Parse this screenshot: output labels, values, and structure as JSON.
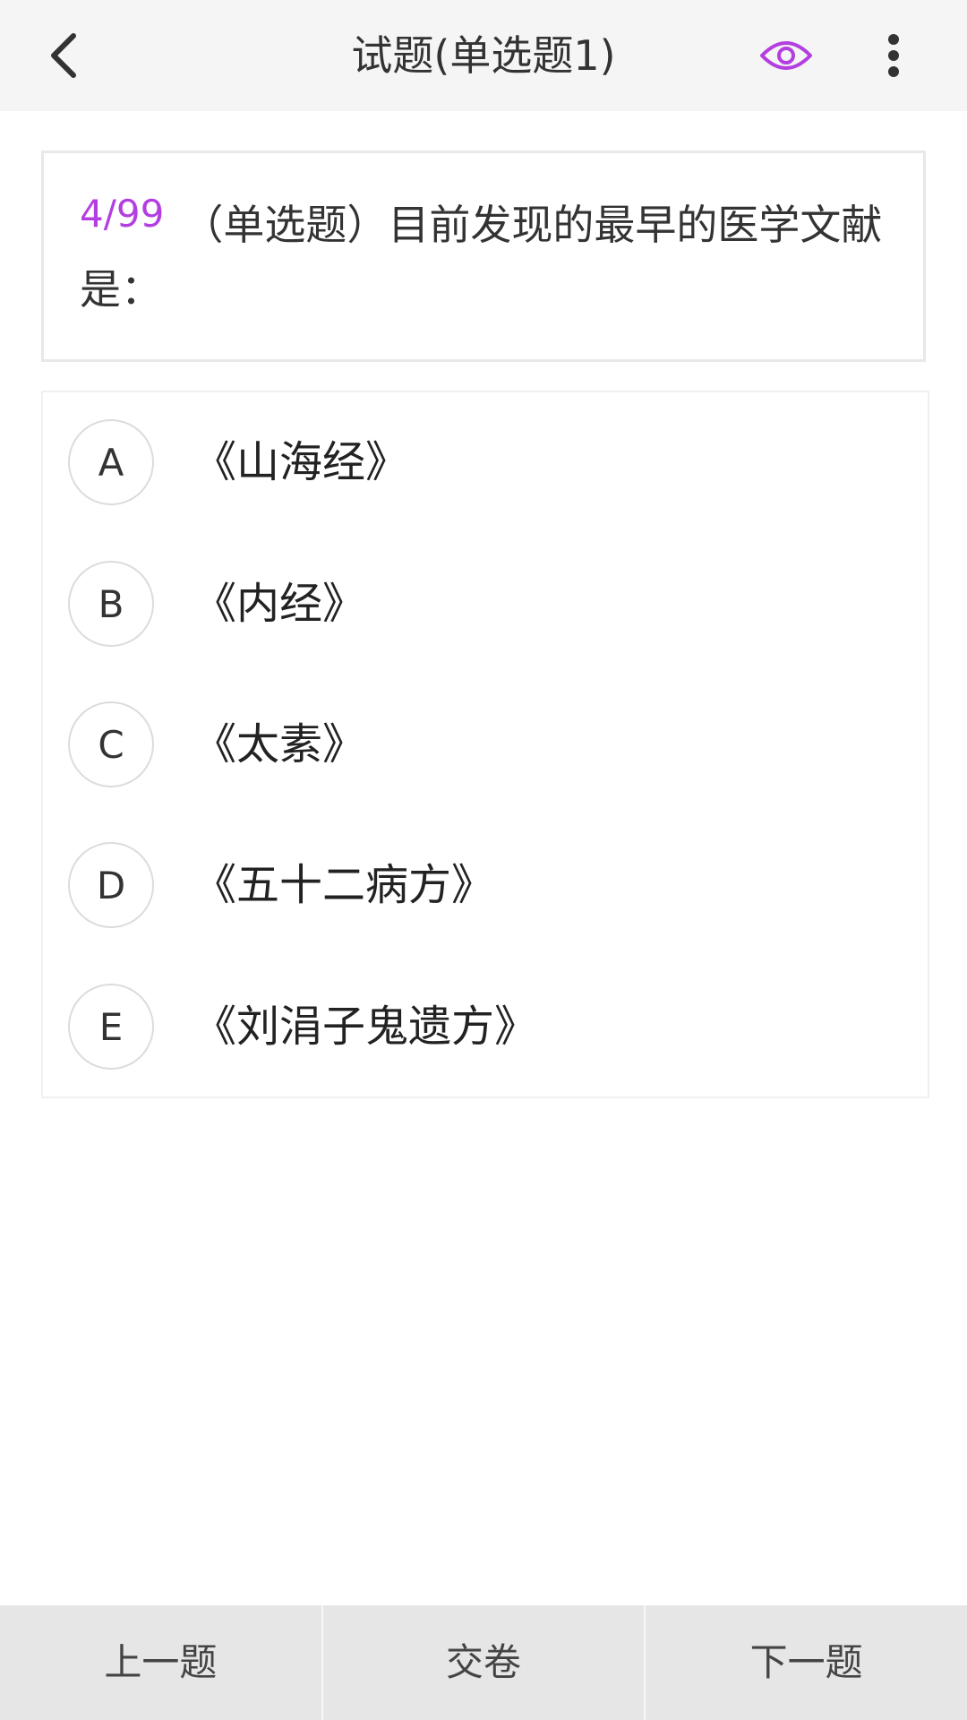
{
  "header": {
    "title": "试题(单选题1)",
    "back_icon": "chevron-left-icon",
    "eye_icon": "eye-icon",
    "more_icon": "more-vertical-icon",
    "accent_color": "#b33fe0"
  },
  "question": {
    "index": "4/99",
    "text": "（单选题）目前发现的最早的医学文献是："
  },
  "options": [
    {
      "letter": "A",
      "text": "《山海经》"
    },
    {
      "letter": "B",
      "text": "《内经》"
    },
    {
      "letter": "C",
      "text": "《太素》"
    },
    {
      "letter": "D",
      "text": "《五十二病方》"
    },
    {
      "letter": "E",
      "text": "《刘涓子鬼遗方》"
    }
  ],
  "footer": {
    "prev_label": "上一题",
    "submit_label": "交卷",
    "next_label": "下一题"
  }
}
